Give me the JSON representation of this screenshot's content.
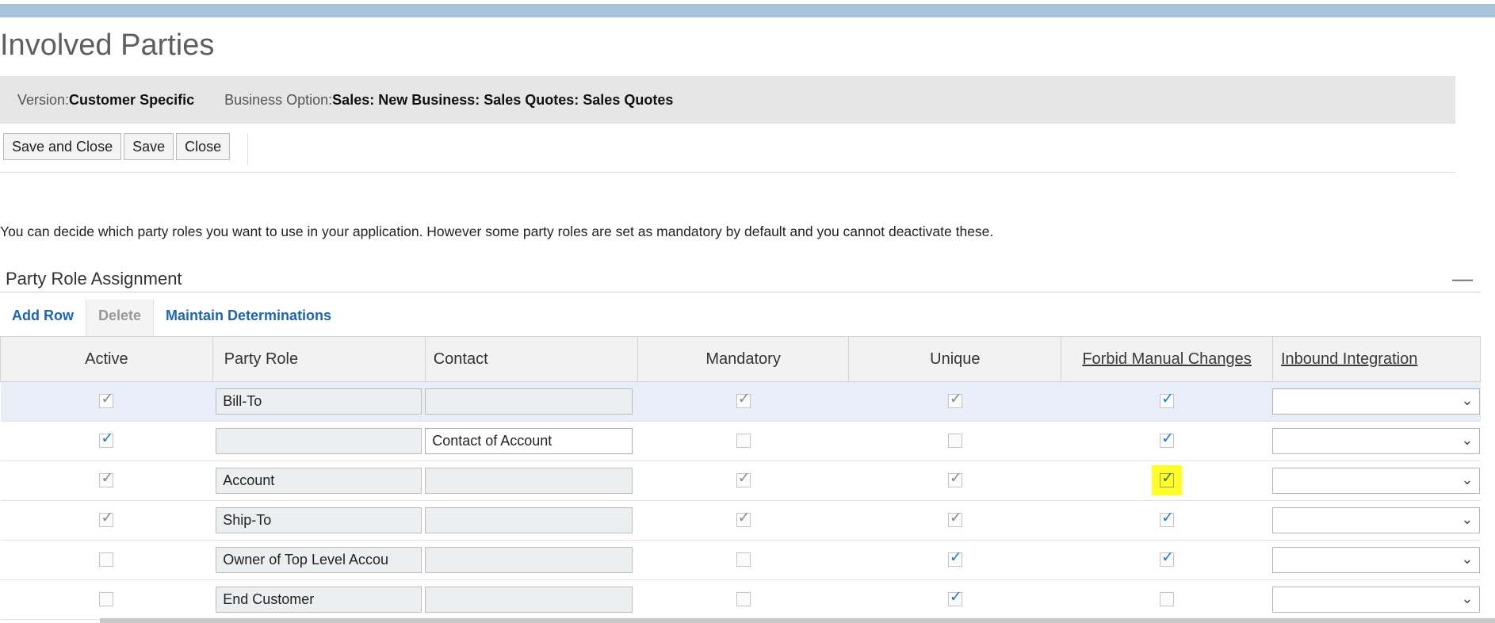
{
  "page": {
    "title": "Involved Parties"
  },
  "info": {
    "version_label": "Version:",
    "version_value": "Customer Specific",
    "option_label": "Business Option:",
    "option_value": "Sales: New Business: Sales Quotes: Sales Quotes"
  },
  "toolbar": {
    "save_close": "Save and Close",
    "save": "Save",
    "close": "Close"
  },
  "description": "You can decide which party roles you want to use in your application. However some party roles are set as mandatory by default and you cannot deactivate these.",
  "section": {
    "title": "Party Role Assignment",
    "actions": {
      "add_row": "Add Row",
      "delete": "Delete",
      "maintain": "Maintain Determinations"
    }
  },
  "table": {
    "headers": {
      "active": "Active",
      "party_role": "Party Role",
      "contact": "Contact",
      "mandatory": "Mandatory",
      "unique": "Unique",
      "forbid": "Forbid Manual Changes",
      "inbound": "Inbound Integration"
    },
    "rows": [
      {
        "active": "grey",
        "party_role": "Bill-To",
        "contact": "",
        "mandatory": "grey",
        "unique": "grey",
        "forbid": "blue",
        "inbound": ""
      },
      {
        "active": "blue",
        "party_role": "",
        "contact": "Contact of Account",
        "mandatory": "none",
        "unique": "none",
        "forbid": "blue",
        "inbound": ""
      },
      {
        "active": "grey",
        "party_role": "Account",
        "contact": "",
        "mandatory": "grey",
        "unique": "grey",
        "forbid": "highlight",
        "inbound": ""
      },
      {
        "active": "grey",
        "party_role": "Ship-To",
        "contact": "",
        "mandatory": "grey",
        "unique": "grey",
        "forbid": "blue",
        "inbound": ""
      },
      {
        "active": "none",
        "party_role": "Owner of Top Level Accou",
        "contact": "",
        "mandatory": "none",
        "unique": "blue",
        "forbid": "blue",
        "inbound": ""
      },
      {
        "active": "none",
        "party_role": "End Customer",
        "contact": "",
        "mandatory": "none",
        "unique": "blue",
        "forbid": "none",
        "inbound": ""
      }
    ]
  },
  "icons": {
    "collapse": "minus-icon",
    "dropdown": "chevron-down-icon",
    "check": "checkmark-icon"
  },
  "colors": {
    "accent_blue": "#1e65ad",
    "highlight": "#ffff26",
    "header_bar": "#a9c3dc"
  }
}
